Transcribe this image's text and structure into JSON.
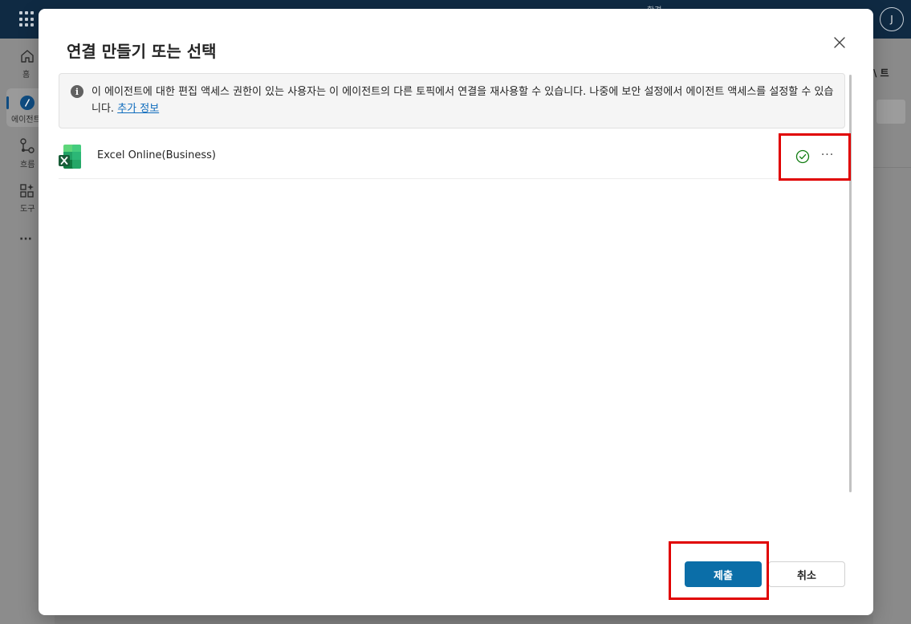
{
  "topbar": {
    "environment_label": "환경",
    "avatar_initial": "J"
  },
  "left_rail": {
    "items": [
      {
        "label": "홈",
        "icon": "home-icon"
      },
      {
        "label": "에이전트",
        "icon": "agent-icon"
      },
      {
        "label": "흐름",
        "icon": "flow-icon"
      },
      {
        "label": "도구",
        "icon": "tools-icon"
      },
      {
        "label": "···",
        "icon": "more-icon"
      }
    ]
  },
  "background_right": {
    "text": "\\ 트"
  },
  "dialog": {
    "title": "연결 만들기 또는 선택",
    "close_icon": "close-icon",
    "info": {
      "text": "이 에이전트에 대한 편집 액세스 권한이 있는 사용자는 이 에이전트의 다른 토픽에서 연결을 재사용할 수 있습니다. 나중에 보안 설정에서 에이전트 액세스를 설정할 수 있습니다. ",
      "link": "추가 정보"
    },
    "connections": [
      {
        "name": "Excel Online(Business)",
        "icon": "excel-icon",
        "status": "connected",
        "more": "···"
      }
    ],
    "buttons": {
      "submit": "제출",
      "cancel": "취소"
    }
  },
  "colors": {
    "primary": "#0b6ea8",
    "highlight": "#e00000",
    "success": "#107c10",
    "link": "#0f6cbd"
  }
}
